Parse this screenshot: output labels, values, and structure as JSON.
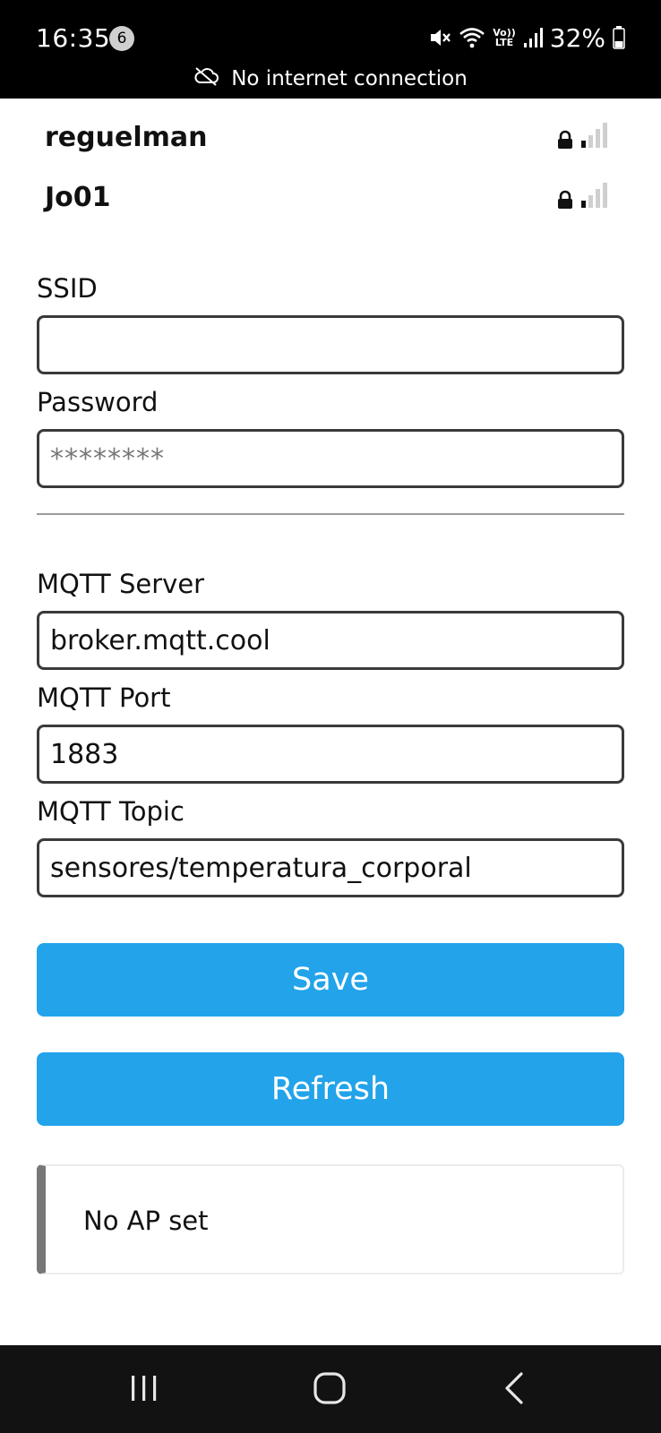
{
  "status_bar": {
    "time": "16:35",
    "notification_count": "6",
    "battery_percent": "32%",
    "network_lte_top": "Vo))",
    "network_lte_bottom": "LTE",
    "connection_message": "No internet connection",
    "icons": [
      "mute-icon",
      "wifi-icon",
      "lte-icon",
      "signal-icon",
      "battery-icon",
      "cloud-off-icon"
    ]
  },
  "networks": [
    {
      "ssid": "reguelman",
      "secured": true,
      "signal_bars": 1,
      "signal_max": 4
    },
    {
      "ssid": "Jo01",
      "secured": true,
      "signal_bars": 1,
      "signal_max": 4
    }
  ],
  "form": {
    "ssid_label": "SSID",
    "ssid_value": "",
    "password_label": "Password",
    "password_placeholder": "********",
    "mqtt_server_label": "MQTT Server",
    "mqtt_server_value": "broker.mqtt.cool",
    "mqtt_port_label": "MQTT Port",
    "mqtt_port_value": "1883",
    "mqtt_topic_label": "MQTT Topic",
    "mqtt_topic_value": "sensores/temperatura_corporal"
  },
  "buttons": {
    "save_label": "Save",
    "refresh_label": "Refresh"
  },
  "message": {
    "text": "No AP set"
  },
  "colors": {
    "button_bg": "#22a3ea",
    "message_border": "#777777",
    "status_bar_bg": "#000000",
    "nav_bar_bg": "#121212"
  },
  "nav_bar": {
    "icons": [
      "recent-apps-icon",
      "home-icon",
      "back-icon"
    ]
  }
}
